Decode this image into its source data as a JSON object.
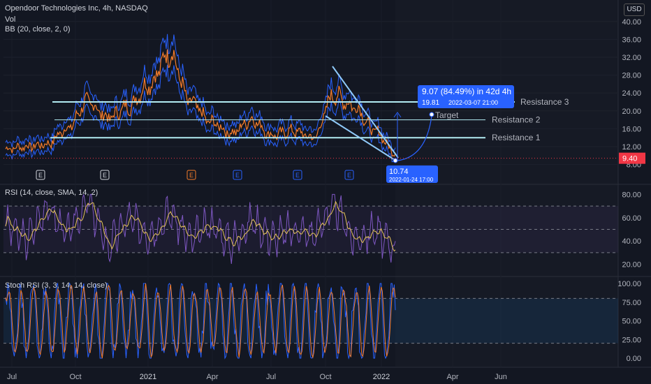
{
  "header": {
    "title": "Opendoor Technologies Inc, 4h, NASDAQ",
    "vol": "Vol",
    "bb": "BB (20, close, 2, 0)",
    "currency": "USD"
  },
  "rsi_label": "RSI (14, close, SMA, 14, 2)",
  "stoch_label": "Stoch RSI (3, 3, 14, 14, close)",
  "annotations": {
    "measure_line1": "9.07 (84.49%) in 42d 4h",
    "measure_line2": "19.81",
    "measure_line2_time": "2022-03-07  21:00",
    "low_value": "10.74",
    "low_time": "2022-01-24 17:00",
    "target": "Target",
    "last_price": "9.40",
    "resistance": [
      "Resistance 1",
      "Resistance 2",
      "Resistance 3"
    ]
  },
  "colors": {
    "price": "#f57c2a",
    "bb": "#2962ff",
    "rsi": "#7e57c2",
    "rsi_ma": "#e6c35a",
    "stoch_k": "#2962ff",
    "stoch_d": "#f57c2a",
    "resistance": "#b2ebf2",
    "accent": "#2962ff",
    "last_price": "#f23645"
  },
  "chart_data": [
    {
      "type": "line",
      "name": "price",
      "title": "Opendoor Technologies Inc, 4h, NASDAQ",
      "x_ticks": [
        "Jul",
        "Oct",
        "2021",
        "Apr",
        "Jul",
        "Oct",
        "2022",
        "Apr",
        "Jun"
      ],
      "y_ticks": [
        8,
        12,
        16,
        20,
        24,
        28,
        32,
        36,
        40
      ],
      "ylim": [
        7,
        42
      ],
      "x": [
        "2020-06",
        "2020-07",
        "2020-08",
        "2020-09",
        "2020-10",
        "2020-11",
        "2020-12",
        "2021-01",
        "2021-02",
        "2021-03",
        "2021-04",
        "2021-05",
        "2021-06",
        "2021-07",
        "2021-08",
        "2021-09",
        "2021-10",
        "2021-11",
        "2021-12",
        "2022-01"
      ],
      "values": [
        11.5,
        12.0,
        12.5,
        16.0,
        22.0,
        18.5,
        21.0,
        26.0,
        33.0,
        22.0,
        17.5,
        15.0,
        18.0,
        14.5,
        15.5,
        14.0,
        23.5,
        21.0,
        15.5,
        10.7
      ],
      "resistance_levels": [
        {
          "name": "Resistance 1",
          "value": 14.0
        },
        {
          "name": "Resistance 2",
          "value": 18.0
        },
        {
          "name": "Resistance 3",
          "value": 22.0
        }
      ],
      "last_price": 9.4,
      "grid": true
    },
    {
      "type": "line",
      "name": "RSI (14, close, SMA, 14, 2)",
      "y_ticks": [
        20,
        40,
        60,
        80
      ],
      "ylim": [
        15,
        85
      ],
      "bands": [
        30,
        50,
        70
      ],
      "values": [
        55,
        40,
        70,
        45,
        75,
        35,
        60,
        45,
        65,
        40,
        55,
        38,
        58,
        42,
        50,
        45,
        72,
        40,
        50,
        30
      ]
    },
    {
      "type": "line",
      "name": "Stoch RSI (3, 3, 14, 14, close)",
      "y_ticks": [
        0.0,
        25.0,
        50.0,
        75.0,
        100.0
      ],
      "ylim": [
        0,
        100
      ],
      "bands": [
        20,
        80
      ],
      "series": [
        {
          "name": "K",
          "values": [
            5,
            95,
            10,
            90,
            20,
            100,
            0,
            85,
            30,
            95,
            5,
            70,
            10,
            100,
            15,
            90,
            5,
            95,
            0,
            45
          ]
        },
        {
          "name": "D",
          "values": [
            15,
            85,
            20,
            80,
            30,
            90,
            10,
            75,
            40,
            85,
            15,
            60,
            20,
            90,
            25,
            80,
            15,
            85,
            10,
            40
          ]
        }
      ]
    }
  ]
}
